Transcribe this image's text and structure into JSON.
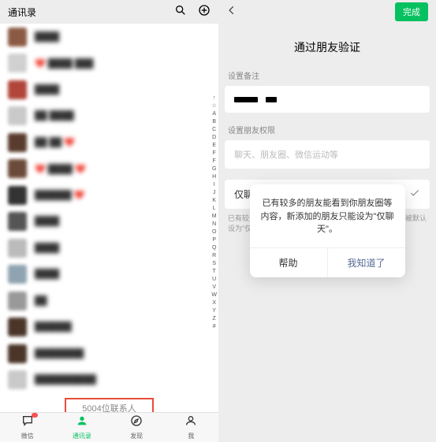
{
  "left": {
    "title": "通讯录",
    "contacts": [
      {
        "avatar_bg": "#8a5a44"
      },
      {
        "avatar_bg": "#d0d0d0"
      },
      {
        "avatar_bg": "#b0453a"
      },
      {
        "avatar_bg": "#c9c9c9"
      },
      {
        "avatar_bg": "#5a3c2e"
      },
      {
        "avatar_bg": "#6b4a3a"
      },
      {
        "avatar_bg": "#333"
      },
      {
        "avatar_bg": "#555"
      },
      {
        "avatar_bg": "#bbb"
      },
      {
        "avatar_bg": "#8fa3b0"
      },
      {
        "avatar_bg": "#999"
      },
      {
        "avatar_bg": "#4a3528"
      },
      {
        "avatar_bg": "#4a3528"
      },
      {
        "avatar_bg": "#c9c9c9"
      }
    ],
    "contact_names": [
      "████",
      "❤️ ████ ███",
      "████",
      "██ ████",
      "██ ██ ❤️",
      "❤️ ████ ❤️",
      "██████ ❤️",
      "████",
      "████",
      "████",
      "██",
      "██████",
      "████████",
      "██████████"
    ],
    "index_bar": [
      "↑",
      "☆",
      "A",
      "B",
      "C",
      "D",
      "E",
      "F",
      "F",
      "G",
      "H",
      "I",
      "J",
      "K",
      "L",
      "M",
      "N",
      "O",
      "P",
      "Q",
      "R",
      "S",
      "T",
      "U",
      "V",
      "W",
      "X",
      "Y",
      "Z",
      "#"
    ],
    "contact_count": "5004位联系人",
    "tabs": [
      "微信",
      "通讯录",
      "发现",
      "我"
    ]
  },
  "right": {
    "done": "完成",
    "title": "通过朋友验证",
    "remark_label": "设置备注",
    "privacy_label": "设置朋友权限",
    "privacy_placeholder": "聊天、朋友圈、微信运动等",
    "privacy_option": "仅聊天",
    "hint": "已有较多的朋友能看到你朋友圈等内容，新添加的朋友会被默认设为\"仅聊天\"",
    "dialog": {
      "body": "已有较多的朋友能看到你朋友圈等内容，新添加的朋友只能设为\"仅聊天\"。",
      "help": "帮助",
      "ok": "我知道了"
    }
  }
}
